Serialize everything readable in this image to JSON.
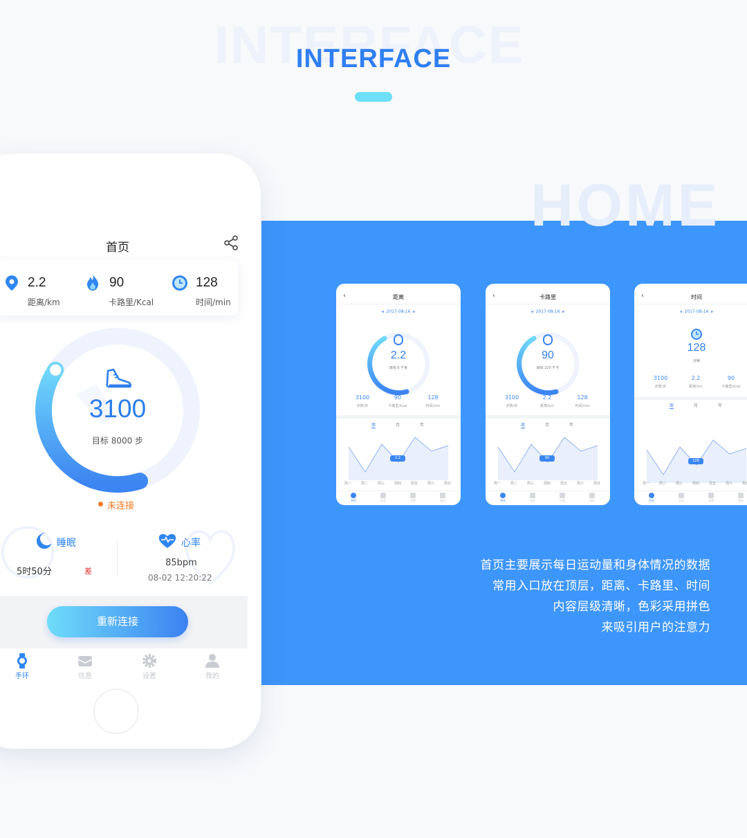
{
  "header": {
    "bg_word": "INTERFACE",
    "title": "INTERFACE"
  },
  "section_bg_word": "HOME",
  "colors": {
    "accent": "#3d96fb",
    "brand_blue": "#2f7ff2",
    "cyan": "#6de0f7",
    "warning": "#f47a23",
    "bad": "#e2312f"
  },
  "phone": {
    "title": "首页",
    "share_icon": "share-icon",
    "stats": [
      {
        "icon": "location-pin-icon",
        "value": "2.2",
        "label": "距离/km"
      },
      {
        "icon": "flame-icon",
        "value": "90",
        "label": "卡路里/Kcal"
      },
      {
        "icon": "clock-icon",
        "value": "128",
        "label": "时间/min"
      }
    ],
    "ring": {
      "steps": "3100",
      "goal": "目标 8000 步",
      "progress": 0.39
    },
    "status": "未连接",
    "sleep": {
      "label": "睡眠",
      "time": "5时50分",
      "quality": "差"
    },
    "heart": {
      "label": "心率",
      "bpm": "85bpm",
      "time": "08-02  12:20:22"
    },
    "reconnect_button": "重新连接",
    "tabs": [
      {
        "label": "手环",
        "icon": "watch-icon",
        "active": true
      },
      {
        "label": "信息",
        "icon": "message-icon",
        "active": false
      },
      {
        "label": "设置",
        "icon": "settings-gear-icon",
        "active": false
      },
      {
        "label": "我的",
        "icon": "user-icon",
        "active": false
      }
    ]
  },
  "mini_screens": [
    {
      "title": "距离",
      "date": "2017-08-16",
      "value": "2.2",
      "sub": "目标 6 千米",
      "stats": [
        {
          "value": "3100",
          "label": "步数/步"
        },
        {
          "value": "90",
          "label": "卡路里/Kcal"
        },
        {
          "value": "128",
          "label": "时间/min"
        }
      ],
      "tip": "2.2"
    },
    {
      "title": "卡路里",
      "date": "2017-08-16",
      "value": "90",
      "sub": "目标 220 千卡",
      "stats": [
        {
          "value": "3100",
          "label": "步数/步"
        },
        {
          "value": "2.2",
          "label": "距离/km"
        },
        {
          "value": "128",
          "label": "时间/min"
        }
      ],
      "tip": "90"
    },
    {
      "title": "时间",
      "date": "2017-08-16",
      "value": "128",
      "sub": "分钟",
      "stats": [
        {
          "value": "3100",
          "label": "步数/步"
        },
        {
          "value": "2.2",
          "label": "距离/km"
        },
        {
          "value": "90",
          "label": "卡路里/Kcal"
        }
      ],
      "tip": "128"
    }
  ],
  "mini_common": {
    "period_tabs": [
      "周",
      "月",
      "年"
    ],
    "days": [
      "周一",
      "周二",
      "周三",
      "周四",
      "周五",
      "周六",
      "周日"
    ],
    "nav": [
      "手环",
      "信息",
      "设置",
      "我的"
    ]
  },
  "description": [
    "首页主要展示每日运动量和身体情况的数据",
    "常用入口放在顶层，距离、卡路里、时间",
    "内容层级清晰，色彩采用拼色",
    "来吸引用户的注意力"
  ]
}
